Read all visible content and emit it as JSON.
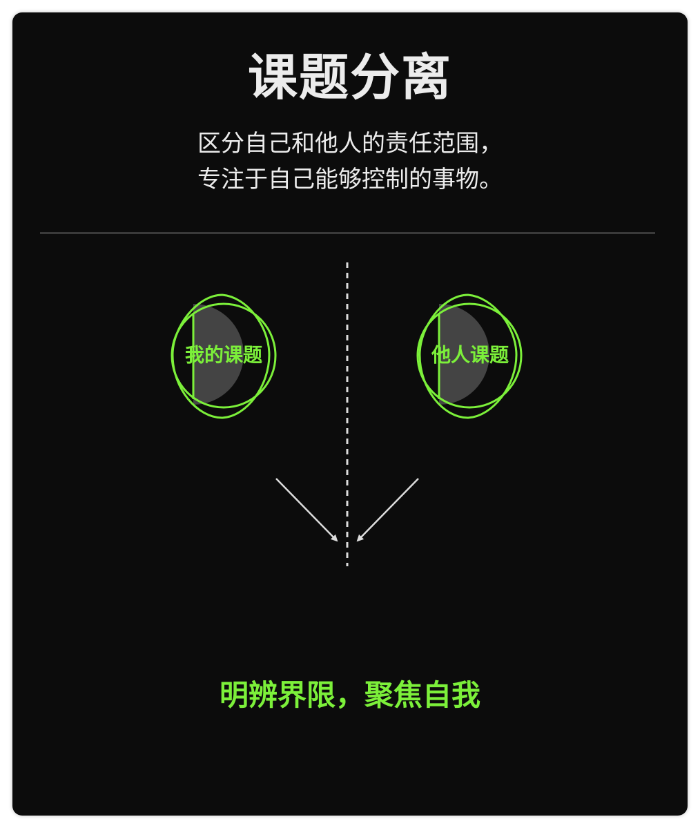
{
  "header": {
    "title": "课题分离",
    "subtitle_line1": "区分自己和他人的责任范围，",
    "subtitle_line2": "专注于自己能够控制的事物。"
  },
  "diagram": {
    "left_label": "我的课题",
    "right_label": "他人课题",
    "accent_color": "#7cf03a",
    "fill_color": "#444444"
  },
  "footer": {
    "slogan": "明辨界限，聚焦自我"
  }
}
